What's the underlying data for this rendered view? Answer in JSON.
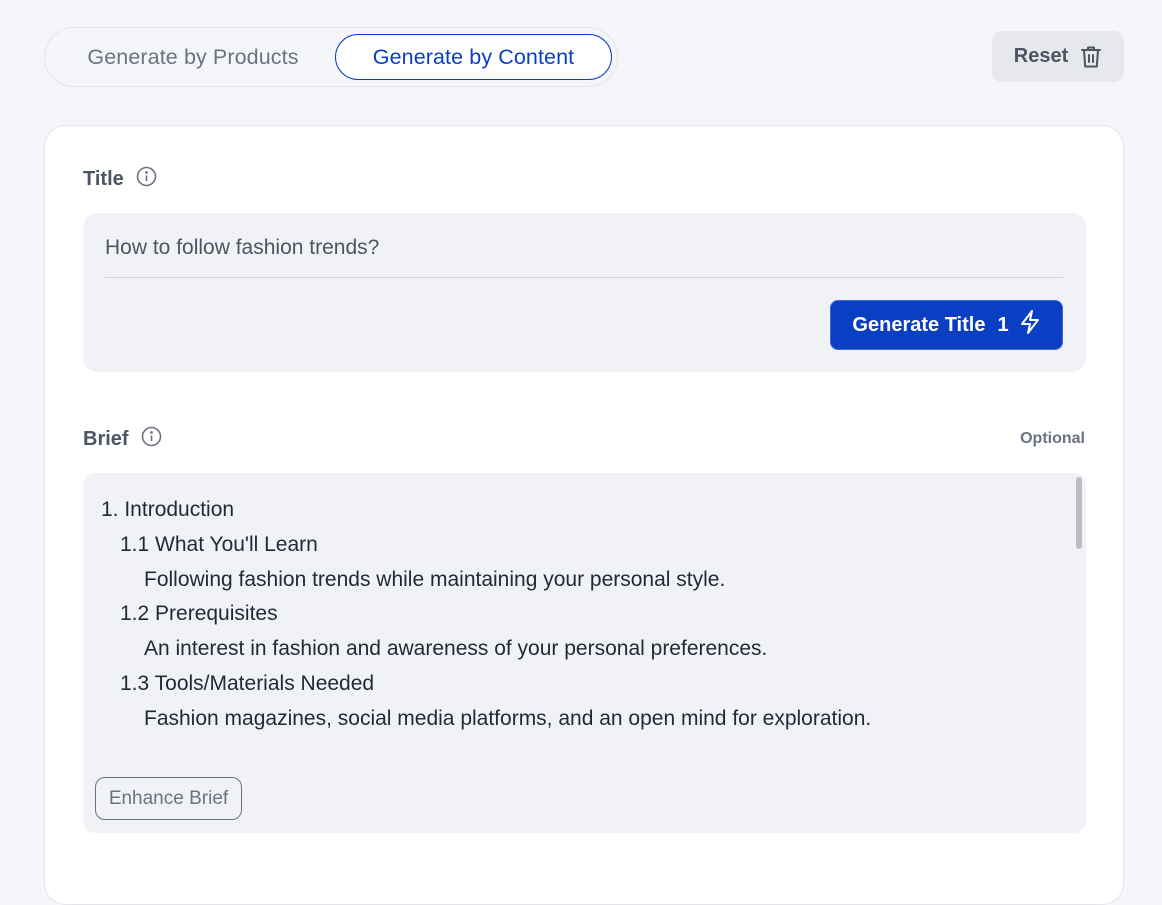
{
  "mode_toggle": {
    "products_label": "Generate by Products",
    "content_label": "Generate by Content",
    "selected": "content"
  },
  "reset": {
    "label": "Reset",
    "icon": "trash-icon"
  },
  "title_section": {
    "label": "Title",
    "info_icon": "info-icon",
    "input_value": "How to follow fashion trends?",
    "generate_button": {
      "label": "Generate Title",
      "count": "1",
      "icon": "lightning-icon"
    }
  },
  "brief_section": {
    "label": "Brief",
    "info_icon": "info-icon",
    "optional_label": "Optional",
    "lines": [
      {
        "level": 1,
        "text": "1. Introduction"
      },
      {
        "level": 2,
        "text": "1.1 What You'll Learn"
      },
      {
        "level": 3,
        "text": "Following fashion trends while maintaining your personal style."
      },
      {
        "level": 2,
        "text": "1.2 Prerequisites"
      },
      {
        "level": 3,
        "text": "An interest in fashion and awareness of your personal preferences."
      },
      {
        "level": 2,
        "text": "1.3 Tools/Materials Needed"
      },
      {
        "level": 3,
        "text": "Fashion magazines, social media platforms, and an open mind for exploration."
      }
    ],
    "enhance_button": "Enhance Brief"
  },
  "colors": {
    "accent": "#0a3fc4",
    "background": "#f5f6f9",
    "field_background": "#f1f2f6"
  }
}
